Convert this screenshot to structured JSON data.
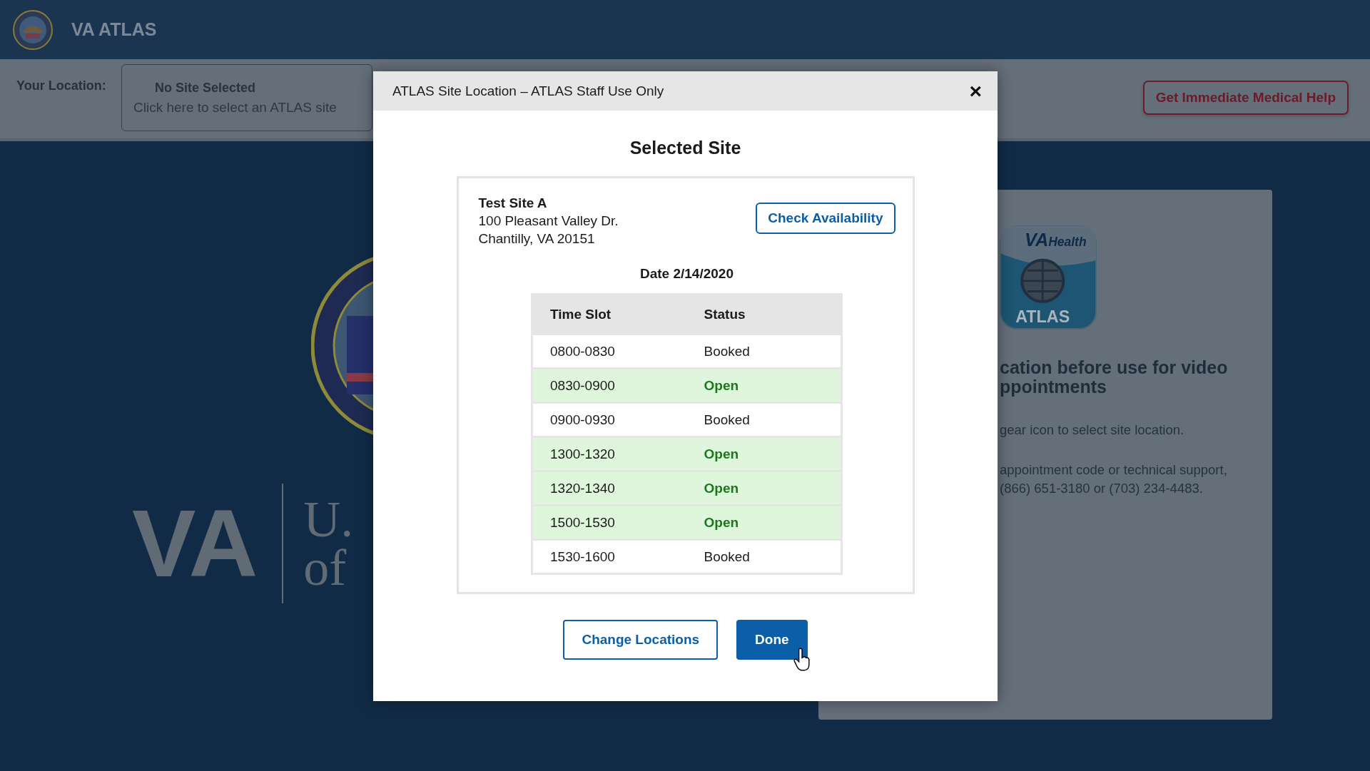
{
  "header": {
    "title": "VA ATLAS"
  },
  "location_bar": {
    "label": "Your Location:",
    "site_title": "No Site Selected",
    "site_hint": "Click here to select an ATLAS site",
    "help_button": "Get Immediate Medical Help"
  },
  "background_logo": {
    "letters": "VA",
    "line_1": "U.",
    "line_2": "of"
  },
  "info_card": {
    "app_icon": {
      "brand": "VA",
      "brand_suffix": "Health",
      "label": "ATLAS"
    },
    "heading_lines": [
      "cation before use for video",
      "ppointments"
    ],
    "paragraphs": [
      [
        "gear icon to select site location."
      ],
      [
        "appointment code or technical support,",
        "(866) 651-3180 or (703) 234-4483."
      ]
    ]
  },
  "modal": {
    "title": "ATLAS Site Location – ATLAS Staff Use Only",
    "close": "×",
    "heading": "Selected Site",
    "site": {
      "name": "Test Site A",
      "address_1": "100 Pleasant Valley Dr.",
      "address_2": "Chantilly, VA 20151",
      "check_button": "Check Availability"
    },
    "date": "Date 2/14/2020",
    "table": {
      "columns": [
        "Time Slot",
        "Status"
      ],
      "rows": [
        {
          "time": "0800-0830",
          "status": "Booked",
          "available": false
        },
        {
          "time": "0830-0900",
          "status": "Open",
          "available": true
        },
        {
          "time": "0900-0930",
          "status": "Booked",
          "available": false
        },
        {
          "time": "1300-1320",
          "status": "Open",
          "available": true
        },
        {
          "time": "1320-1340",
          "status": "Open",
          "available": true
        },
        {
          "time": "1500-1530",
          "status": "Open",
          "available": true
        },
        {
          "time": "1530-1600",
          "status": "Booked",
          "available": false
        }
      ]
    },
    "buttons": [
      "Change Locations",
      "Done"
    ]
  }
}
